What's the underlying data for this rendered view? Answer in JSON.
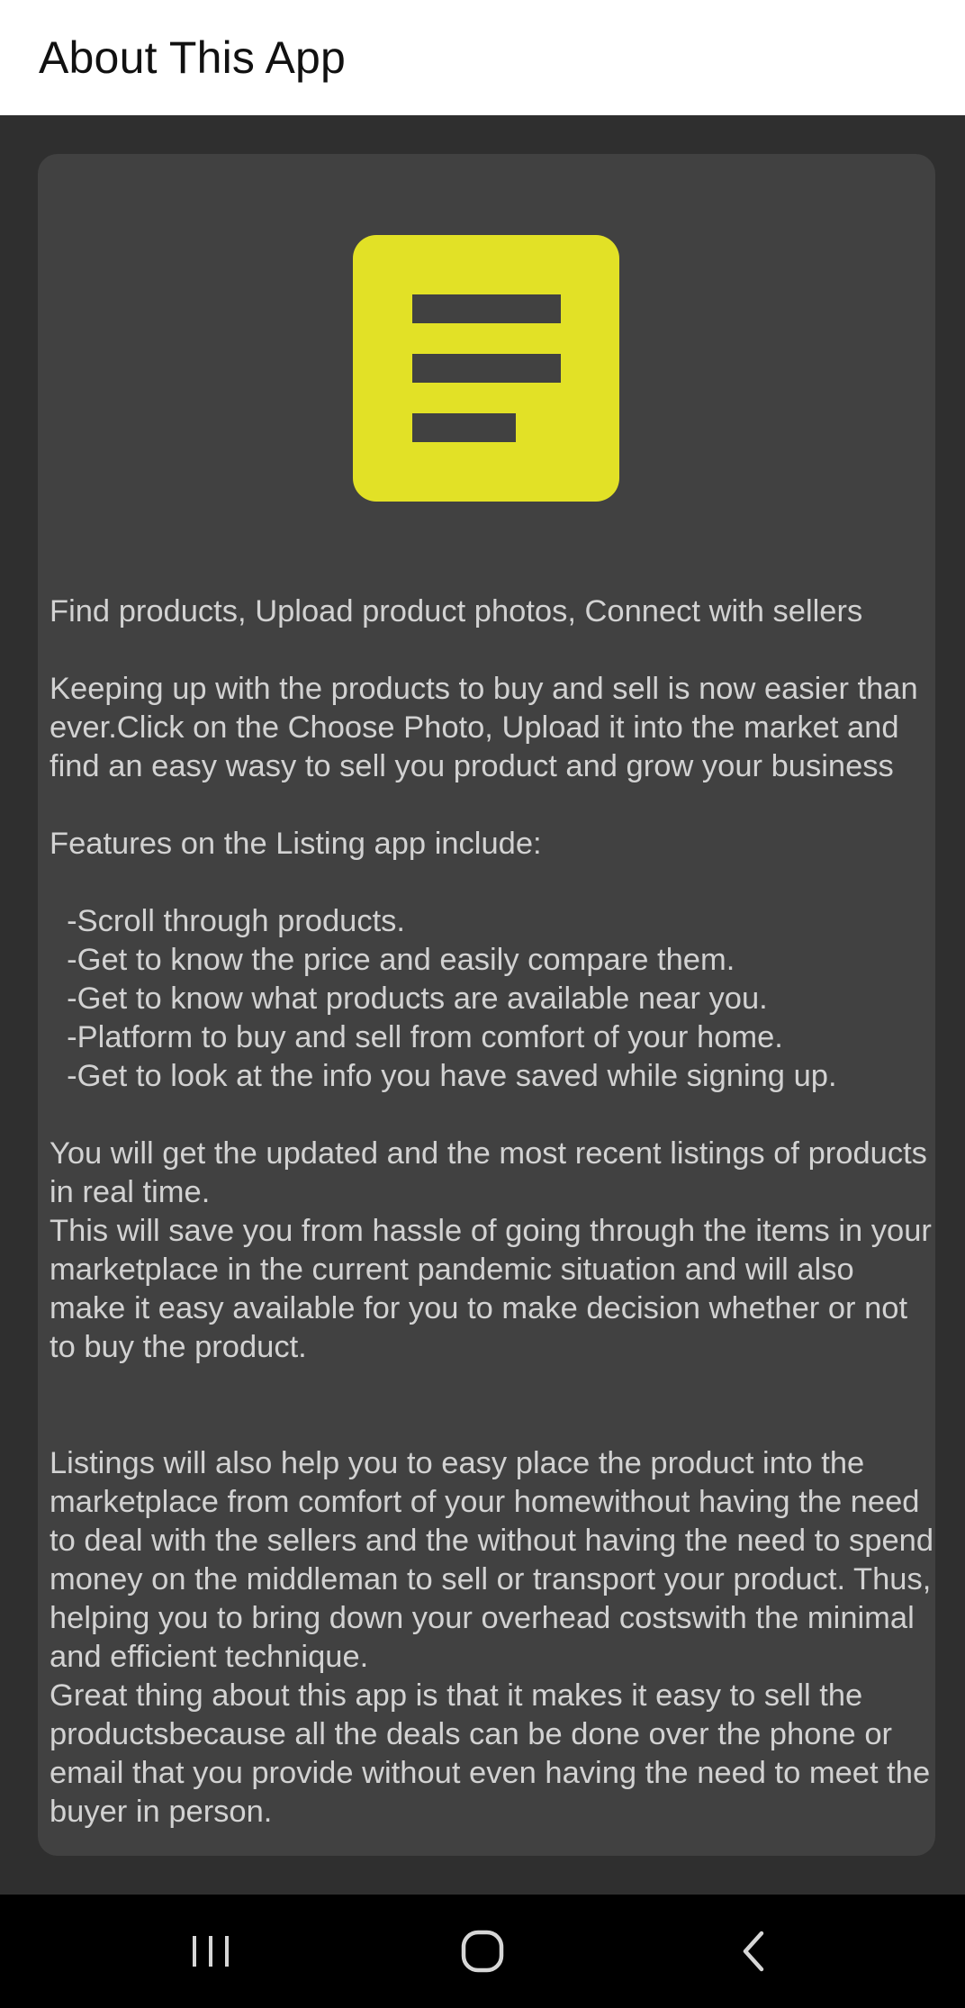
{
  "app_bar": {
    "title": "About This App"
  },
  "logo": {
    "icon": "listing-logo-icon",
    "color": "#e2e126"
  },
  "description": {
    "text": "Find products, Upload product photos, Connect with sellers\n\nKeeping up with the products to buy and sell is now easier than ever.Click on the Choose Photo, Upload it into the market and find an easy wasy to sell you product and grow your business\n\nFeatures on the Listing app include:\n\n  -Scroll through products.\n  -Get to know the price and easily compare them.\n  -Get to know what products are available near you.\n  -Platform to buy and sell from comfort of your home.\n  -Get to look at the info you have saved while signing up.\n\nYou will get the updated and the most recent listings of products in real time.\nThis will save you from hassle of going through the items in your marketplace in the current pandemic situation and will also make it easy available for you to make decision whether or not to buy the product.\n\n\nListings will also help you to easy place the product into the marketplace from comfort of your homewithout having the need to deal with the sellers and the without having the need to spend money on the middleman to sell or transport your product. Thus, helping you to bring down your overhead costswith the minimal and efficient technique.\nGreat thing about this app is that it makes it easy to sell the productsbecause all the deals can be done over the phone or email that you provide without even having the need to meet the buyer in person."
  },
  "nav_bar": {
    "recents_icon": "recents-icon",
    "home_icon": "home-icon",
    "back_icon": "back-icon"
  }
}
